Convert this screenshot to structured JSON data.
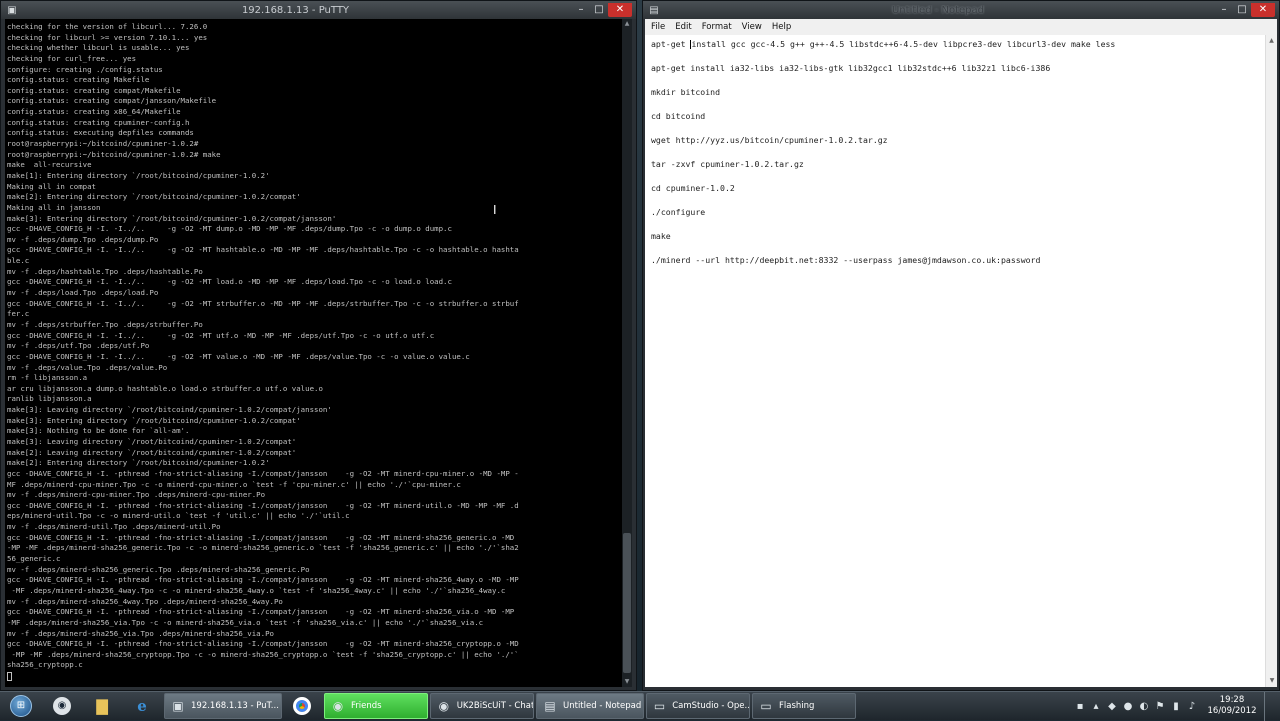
{
  "putty": {
    "title": "192.168.1.13 - PuTTY",
    "icon": "putty-icon",
    "controls": {
      "minimize": "–",
      "maximize": "□",
      "close": "✕"
    },
    "lines": [
      "checking for the version of libcurl... 7.26.0",
      "checking for libcurl >= version 7.10.1... yes",
      "checking whether libcurl is usable... yes",
      "checking for curl_free... yes",
      "configure: creating ./config.status",
      "config.status: creating Makefile",
      "config.status: creating compat/Makefile",
      "config.status: creating compat/jansson/Makefile",
      "config.status: creating x86_64/Makefile",
      "config.status: creating cpuminer-config.h",
      "config.status: executing depfiles commands",
      "root@raspberrypi:~/bitcoind/cpuminer-1.0.2#",
      "root@raspberrypi:~/bitcoind/cpuminer-1.0.2# make",
      "make  all-recursive",
      "make[1]: Entering directory `/root/bitcoind/cpuminer-1.0.2'",
      "Making all in compat",
      "make[2]: Entering directory `/root/bitcoind/cpuminer-1.0.2/compat'",
      "Making all in jansson",
      "make[3]: Entering directory `/root/bitcoind/cpuminer-1.0.2/compat/jansson'",
      "gcc -DHAVE_CONFIG_H -I. -I../..     -g -O2 -MT dump.o -MD -MP -MF .deps/dump.Tpo -c -o dump.o dump.c",
      "mv -f .deps/dump.Tpo .deps/dump.Po",
      "gcc -DHAVE_CONFIG_H -I. -I../..     -g -O2 -MT hashtable.o -MD -MP -MF .deps/hashtable.Tpo -c -o hashtable.o hashta",
      "ble.c",
      "mv -f .deps/hashtable.Tpo .deps/hashtable.Po",
      "gcc -DHAVE_CONFIG_H -I. -I../..     -g -O2 -MT load.o -MD -MP -MF .deps/load.Tpo -c -o load.o load.c",
      "mv -f .deps/load.Tpo .deps/load.Po",
      "gcc -DHAVE_CONFIG_H -I. -I../..     -g -O2 -MT strbuffer.o -MD -MP -MF .deps/strbuffer.Tpo -c -o strbuffer.o strbuf",
      "fer.c",
      "mv -f .deps/strbuffer.Tpo .deps/strbuffer.Po",
      "gcc -DHAVE_CONFIG_H -I. -I../..     -g -O2 -MT utf.o -MD -MP -MF .deps/utf.Tpo -c -o utf.o utf.c",
      "mv -f .deps/utf.Tpo .deps/utf.Po",
      "gcc -DHAVE_CONFIG_H -I. -I../..     -g -O2 -MT value.o -MD -MP -MF .deps/value.Tpo -c -o value.o value.c",
      "mv -f .deps/value.Tpo .deps/value.Po",
      "rm -f libjansson.a",
      "ar cru libjansson.a dump.o hashtable.o load.o strbuffer.o utf.o value.o",
      "ranlib libjansson.a",
      "make[3]: Leaving directory `/root/bitcoind/cpuminer-1.0.2/compat/jansson'",
      "make[3]: Entering directory `/root/bitcoind/cpuminer-1.0.2/compat'",
      "make[3]: Nothing to be done for `all-am'.",
      "make[3]: Leaving directory `/root/bitcoind/cpuminer-1.0.2/compat'",
      "make[2]: Leaving directory `/root/bitcoind/cpuminer-1.0.2/compat'",
      "make[2]: Entering directory `/root/bitcoind/cpuminer-1.0.2'",
      "gcc -DHAVE_CONFIG_H -I. -pthread -fno-strict-aliasing -I./compat/jansson    -g -O2 -MT minerd-cpu-miner.o -MD -MP -",
      "MF .deps/minerd-cpu-miner.Tpo -c -o minerd-cpu-miner.o `test -f 'cpu-miner.c' || echo './'`cpu-miner.c",
      "mv -f .deps/minerd-cpu-miner.Tpo .deps/minerd-cpu-miner.Po",
      "gcc -DHAVE_CONFIG_H -I. -pthread -fno-strict-aliasing -I./compat/jansson    -g -O2 -MT minerd-util.o -MD -MP -MF .d",
      "eps/minerd-util.Tpo -c -o minerd-util.o `test -f 'util.c' || echo './'`util.c",
      "mv -f .deps/minerd-util.Tpo .deps/minerd-util.Po",
      "gcc -DHAVE_CONFIG_H -I. -pthread -fno-strict-aliasing -I./compat/jansson    -g -O2 -MT minerd-sha256_generic.o -MD",
      "-MP -MF .deps/minerd-sha256_generic.Tpo -c -o minerd-sha256_generic.o `test -f 'sha256_generic.c' || echo './'`sha2",
      "56_generic.c",
      "mv -f .deps/minerd-sha256_generic.Tpo .deps/minerd-sha256_generic.Po",
      "gcc -DHAVE_CONFIG_H -I. -pthread -fno-strict-aliasing -I./compat/jansson    -g -O2 -MT minerd-sha256_4way.o -MD -MP",
      " -MF .deps/minerd-sha256_4way.Tpo -c -o minerd-sha256_4way.o `test -f 'sha256_4way.c' || echo './'`sha256_4way.c",
      "mv -f .deps/minerd-sha256_4way.Tpo .deps/minerd-sha256_4way.Po",
      "gcc -DHAVE_CONFIG_H -I. -pthread -fno-strict-aliasing -I./compat/jansson    -g -O2 -MT minerd-sha256_via.o -MD -MP",
      "-MF .deps/minerd-sha256_via.Tpo -c -o minerd-sha256_via.o `test -f 'sha256_via.c' || echo './'`sha256_via.c",
      "mv -f .deps/minerd-sha256_via.Tpo .deps/minerd-sha256_via.Po",
      "gcc -DHAVE_CONFIG_H -I. -pthread -fno-strict-aliasing -I./compat/jansson    -g -O2 -MT minerd-sha256_cryptopp.o -MD",
      " -MP -MF .deps/minerd-sha256_cryptopp.Tpo -c -o minerd-sha256_cryptopp.o `test -f 'sha256_cryptopp.c' || echo './'`",
      "sha256_cryptopp.c"
    ]
  },
  "notepad": {
    "title": "Untitled - Notepad",
    "icon": "notepad-icon",
    "menu": [
      "File",
      "Edit",
      "Format",
      "View",
      "Help"
    ],
    "first_line_before_caret": "apt-get ",
    "first_line_after_caret": "install gcc gcc-4.5 g++ g++-4.5 libstdc++6-4.5-dev libpcre3-dev libcurl3-dev make less",
    "lines": [
      "apt-get install ia32-libs ia32-libs-gtk lib32gcc1 lib32stdc++6 lib32z1 libc6-i386",
      "mkdir bitcoind",
      "cd bitcoind",
      "wget http://yyz.us/bitcoin/cpuminer-1.0.2.tar.gz",
      "tar -zxvf cpuminer-1.0.2.tar.gz",
      "cd cpuminer-1.0.2",
      "./configure",
      "make",
      "./minerd --url http://deepbit.net:8332 --userpass james@jmdawson.co.uk:password"
    ]
  },
  "taskbar": {
    "tasks": [
      {
        "label": "192.168.1.13 - PuT...",
        "icon": "putty-icon"
      },
      {
        "label": "Friends",
        "icon": "steam-icon"
      },
      {
        "label": "UK2BiScUiT - Chat",
        "icon": "steam-icon"
      },
      {
        "label": "Untitled - Notepad",
        "icon": "notepad-icon"
      },
      {
        "label": "CamStudio - Ope...",
        "icon": "camstudio-icon"
      },
      {
        "label": "Flashing",
        "icon": "window-icon"
      }
    ],
    "clock_time": "19:28",
    "clock_date": "16/09/2012"
  }
}
